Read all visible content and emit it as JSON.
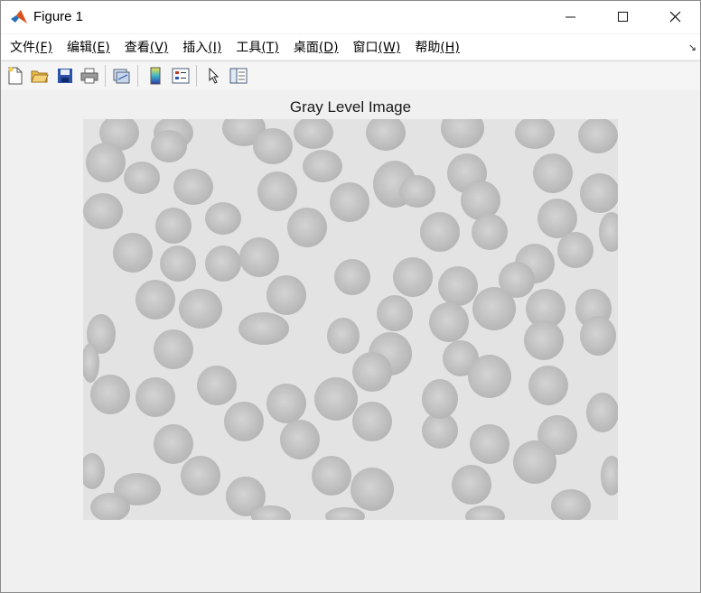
{
  "window": {
    "title": "Figure 1",
    "minimize_glyph": "—",
    "maximize_glyph": "☐",
    "close_glyph": "✕"
  },
  "menu": [
    {
      "label": "文件",
      "key": "(F)",
      "name": "menu-file"
    },
    {
      "label": "编辑",
      "key": "(E)",
      "name": "menu-edit"
    },
    {
      "label": "查看",
      "key": "(V)",
      "name": "menu-view"
    },
    {
      "label": "插入",
      "key": "(I)",
      "name": "menu-insert"
    },
    {
      "label": "工具",
      "key": "(T)",
      "name": "menu-tools"
    },
    {
      "label": "桌面",
      "key": "(D)",
      "name": "menu-desktop"
    },
    {
      "label": "窗口",
      "key": "(W)",
      "name": "menu-window"
    },
    {
      "label": "帮助",
      "key": "(H)",
      "name": "menu-help"
    }
  ],
  "toolbar": {
    "icons": [
      "new-figure-icon",
      "open-file-icon",
      "save-icon",
      "print-icon",
      "link-plot-icon",
      "insert-colorbar-icon",
      "insert-legend-icon",
      "edit-plot-pointer-icon",
      "property-inspector-icon"
    ]
  },
  "figure": {
    "axes_title": "Gray Level Image",
    "image_description_colors": {
      "background": "#e4e4e4",
      "cell": "#bdbdbd",
      "cell_center": "#d2d2d2"
    }
  }
}
